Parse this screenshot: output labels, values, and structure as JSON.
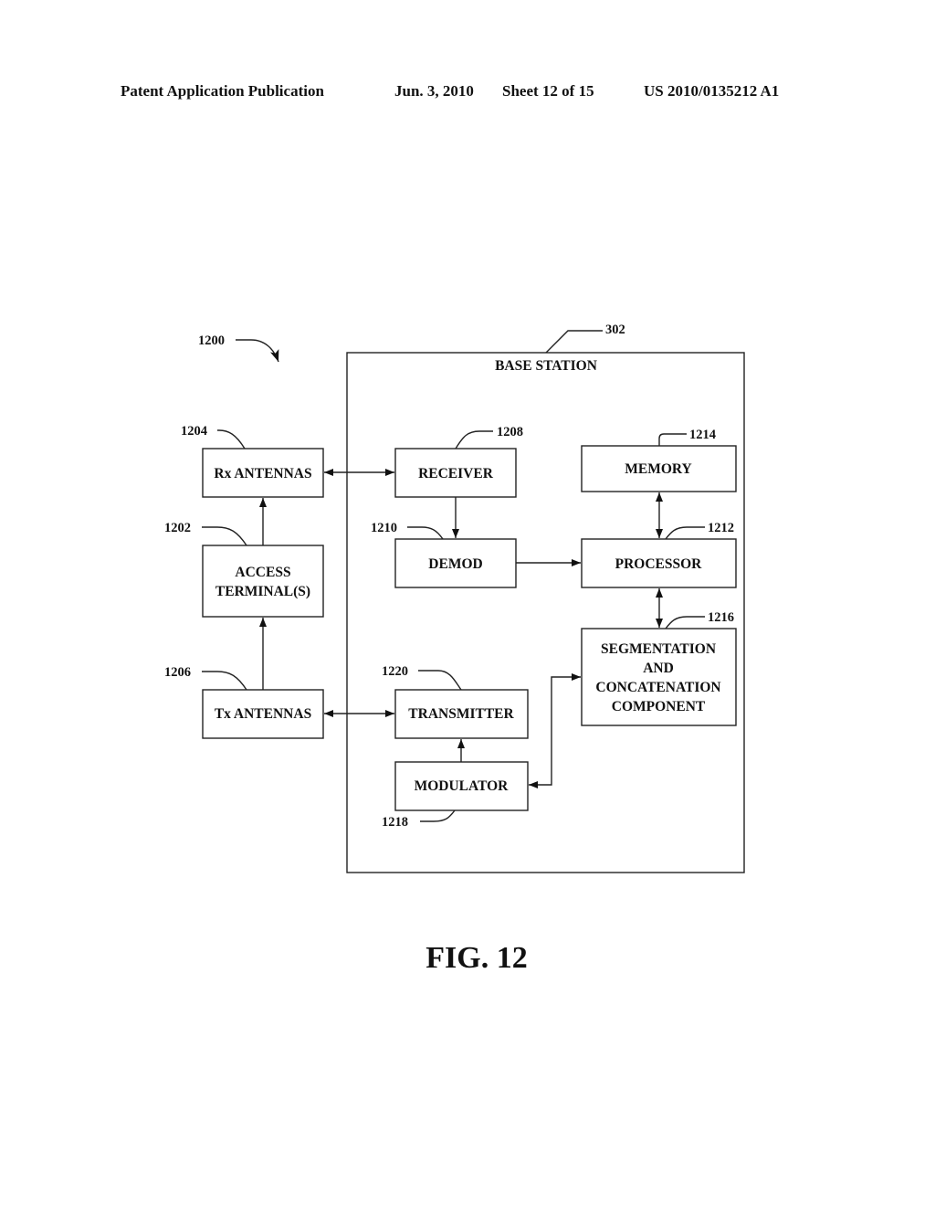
{
  "header": {
    "publication_type": "Patent Application Publication",
    "date": "Jun. 3, 2010",
    "sheet": "Sheet 12 of 15",
    "patent_number": "US 2010/0135212 A1"
  },
  "diagram": {
    "figure_ref": "1200",
    "container": {
      "ref": "302",
      "label": "BASE STATION"
    },
    "blocks": {
      "rx_antennas": {
        "ref": "1204",
        "label": "Rx ANTENNAS"
      },
      "access_terminals": {
        "ref": "1202",
        "lines": [
          "ACCESS",
          "TERMINAL(S)"
        ]
      },
      "tx_antennas": {
        "ref": "1206",
        "label": "Tx ANTENNAS"
      },
      "receiver": {
        "ref": "1208",
        "label": "RECEIVER"
      },
      "demod": {
        "ref": "1210",
        "label": "DEMOD"
      },
      "memory": {
        "ref": "1214",
        "label": "MEMORY"
      },
      "processor": {
        "ref": "1212",
        "label": "PROCESSOR"
      },
      "segmentation": {
        "ref": "1216",
        "lines": [
          "SEGMENTATION",
          "AND",
          "CONCATENATION",
          "COMPONENT"
        ]
      },
      "transmitter": {
        "ref": "1220",
        "label": "TRANSMITTER"
      },
      "modulator": {
        "ref": "1218",
        "label": "MODULATOR"
      }
    },
    "connections": [
      {
        "from": "access_terminals",
        "to": "rx_antennas",
        "direction": "one-way"
      },
      {
        "from": "tx_antennas",
        "to": "access_terminals",
        "direction": "one-way"
      },
      {
        "from": "rx_antennas",
        "to": "receiver",
        "direction": "two-way"
      },
      {
        "from": "tx_antennas",
        "to": "transmitter",
        "direction": "two-way"
      },
      {
        "from": "receiver",
        "to": "demod",
        "direction": "one-way"
      },
      {
        "from": "demod",
        "to": "processor",
        "direction": "one-way"
      },
      {
        "from": "memory",
        "to": "processor",
        "direction": "two-way"
      },
      {
        "from": "processor",
        "to": "segmentation",
        "direction": "two-way"
      },
      {
        "from": "modulator",
        "to": "segmentation",
        "direction": "two-way"
      },
      {
        "from": "modulator",
        "to": "transmitter",
        "direction": "one-way"
      }
    ]
  },
  "caption": "FIG. 12"
}
